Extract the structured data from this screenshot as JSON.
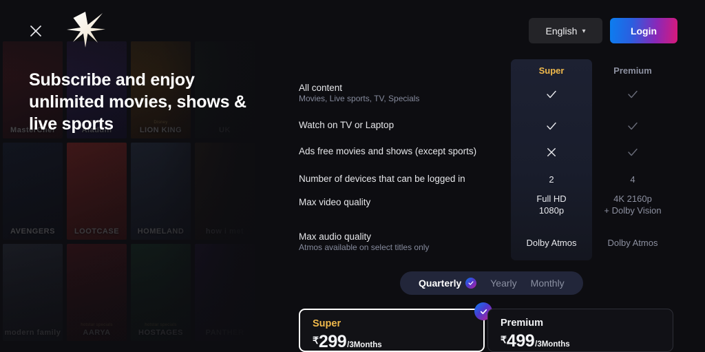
{
  "header": {
    "close_icon": "close-icon",
    "logo": "star-logo",
    "language_label": "English",
    "language_chevron": "chevron-down-icon",
    "login_label": "Login"
  },
  "hero": {
    "heading": "Subscribe and enjoy unlimited movies, shows & live sports"
  },
  "collage": {
    "posters": [
      {
        "title": "MasterChef",
        "sub": "",
        "c1": "#6b1f24",
        "c2": "#2a0d12"
      },
      {
        "title": "Aladdin",
        "sub": "Disney",
        "c1": "#4a2d7a",
        "c2": "#17103a"
      },
      {
        "title": "LION KING",
        "sub": "Disney",
        "c1": "#8a5a12",
        "c2": "#2d1605"
      },
      {
        "title": "UK",
        "sub": "",
        "c1": "#243a2a",
        "c2": "#0f1410"
      },
      {
        "title": "AVENGERS",
        "sub": "",
        "c1": "#1d2740",
        "c2": "#0b0f1a"
      },
      {
        "title": "LOOTCASE",
        "sub": "",
        "c1": "#c8342c",
        "c2": "#5c1410"
      },
      {
        "title": "HOMELAND",
        "sub": "",
        "c1": "#3a4a66",
        "c2": "#141a28"
      },
      {
        "title": "how i met",
        "sub": "",
        "c1": "#4a3520",
        "c2": "#17110a"
      },
      {
        "title": "modern family",
        "sub": "",
        "c1": "#3c4455",
        "c2": "#161a22"
      },
      {
        "title": "AARYA",
        "sub": "hotstar specials",
        "c1": "#7a1d22",
        "c2": "#2a0a0c"
      },
      {
        "title": "HOSTAGES",
        "sub": "hotstar specials",
        "c1": "#1e4a32",
        "c2": "#0a1a12"
      },
      {
        "title": "PANTHER",
        "sub": "",
        "c1": "#3a2060",
        "c2": "#120a22"
      }
    ]
  },
  "table": {
    "columns": [
      {
        "id": "super",
        "label": "Super",
        "highlighted": true,
        "color": "#f0b94b"
      },
      {
        "id": "premium",
        "label": "Premium",
        "highlighted": false,
        "color": "#8c90a0"
      }
    ],
    "rows": [
      {
        "label": "All content",
        "sublabel": "Movies, Live sports, TV, Specials",
        "super": {
          "type": "check"
        },
        "premium": {
          "type": "check"
        }
      },
      {
        "label": "Watch on TV or Laptop",
        "sublabel": "",
        "super": {
          "type": "check"
        },
        "premium": {
          "type": "check"
        }
      },
      {
        "label": "Ads free movies and shows (except sports)",
        "sublabel": "",
        "super": {
          "type": "cross"
        },
        "premium": {
          "type": "check"
        }
      },
      {
        "label": "Number of devices that can be logged in",
        "sublabel": "",
        "super": {
          "type": "text",
          "line1": "2",
          "line2": ""
        },
        "premium": {
          "type": "text",
          "line1": "4",
          "line2": ""
        }
      },
      {
        "label": "Max video quality",
        "sublabel": "",
        "super": {
          "type": "text",
          "line1": "Full HD",
          "line2": "1080p"
        },
        "premium": {
          "type": "text",
          "line1": "4K 2160p",
          "line2": "+ Dolby Vision"
        }
      },
      {
        "label": "Max audio quality",
        "sublabel": "Atmos available on select titles only",
        "super": {
          "type": "text",
          "line1": "Dolby Atmos",
          "line2": ""
        },
        "premium": {
          "type": "text",
          "line1": "Dolby Atmos",
          "line2": ""
        }
      }
    ]
  },
  "billing_toggle": {
    "options": [
      {
        "label": "Quarterly",
        "selected": true
      },
      {
        "label": "Yearly",
        "selected": false
      },
      {
        "label": "Monthly",
        "selected": false
      }
    ]
  },
  "plans": [
    {
      "name": "Super",
      "currency": "₹",
      "amount": "299",
      "period": "/3Months",
      "selected": true
    },
    {
      "name": "Premium",
      "currency": "₹",
      "amount": "499",
      "period": "/3Months",
      "selected": false
    }
  ],
  "colors": {
    "background": "#0d0d11",
    "panel": "#1d2132",
    "accent_gold": "#f0b94b",
    "muted": "#8c90a0",
    "gradient_start": "#0b7ef0",
    "gradient_end": "#d9197a"
  }
}
